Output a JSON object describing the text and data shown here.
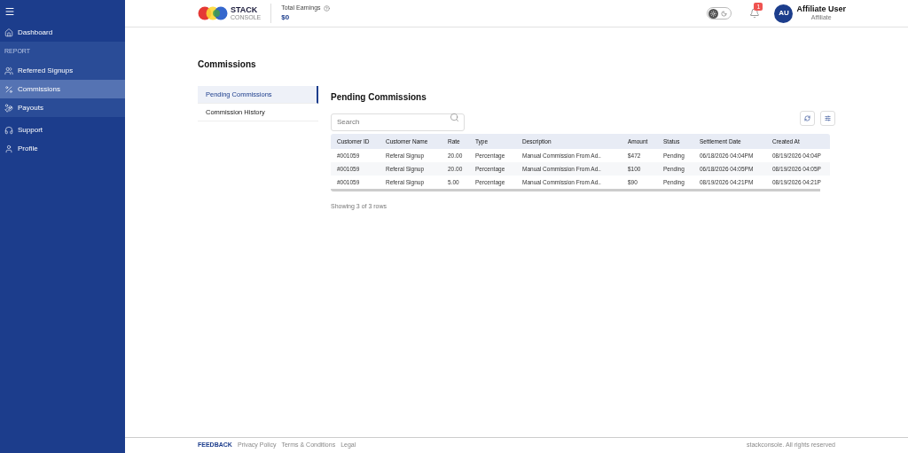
{
  "sidebar": {
    "top": [
      {
        "label": "Dashboard",
        "selected": false
      }
    ],
    "section": {
      "label": "REPORT",
      "items": [
        {
          "label": "Referred Signups",
          "selected": false
        },
        {
          "label": "Commissions",
          "selected": true
        },
        {
          "label": "Payouts",
          "selected": false
        }
      ]
    },
    "bottom": [
      {
        "label": "Support",
        "selected": false
      },
      {
        "label": "Profile",
        "selected": false
      }
    ]
  },
  "header": {
    "logo": {
      "title": "STACK",
      "subtitle": "CONSOLE"
    },
    "earnings": {
      "label": "Total Earnings",
      "value": "$0"
    },
    "theme": {
      "dark": false
    },
    "notifications": {
      "badge": "1"
    },
    "user": {
      "initials": "AU",
      "name": "Affiliate User",
      "role": "Affiliate"
    }
  },
  "page": {
    "title": "Commissions",
    "tabs": [
      {
        "label": "Pending Commissions",
        "selected": true
      },
      {
        "label": "Commission History",
        "selected": false
      }
    ],
    "section_title": "Pending Commissions",
    "search": {
      "placeholder": "Search"
    },
    "table": {
      "columns": [
        "Customer ID",
        "Customer Name",
        "Rate",
        "Type",
        "Description",
        "Amount",
        "Status",
        "Settlement Date",
        "Created At"
      ],
      "rows": [
        [
          "#001059",
          "Referal Signup",
          "20.00",
          "Percentage",
          "Manual Commission From Ad..",
          "$472",
          "Pending",
          "06/18/2026 04:04PM",
          "08/19/2026 04:04P"
        ],
        [
          "#001059",
          "Referal Signup",
          "20.00",
          "Percentage",
          "Manual Commission From Ad..",
          "$100",
          "Pending",
          "06/18/2026 04:05PM",
          "08/19/2026 04:05P"
        ],
        [
          "#001059",
          "Referal Signup",
          "5.00",
          "Percentage",
          "Manual Commission From Ad..",
          "$90",
          "Pending",
          "08/19/2026 04:21PM",
          "08/19/2026 04:21P"
        ]
      ]
    },
    "footer_text": "Showing 3 of 3 rows"
  },
  "footer": {
    "feedback": "FEEDBACK",
    "links": [
      "Privacy Policy",
      "Terms & Conditions",
      "Legal"
    ],
    "copyright": "stackconsole. All rights reserved"
  }
}
